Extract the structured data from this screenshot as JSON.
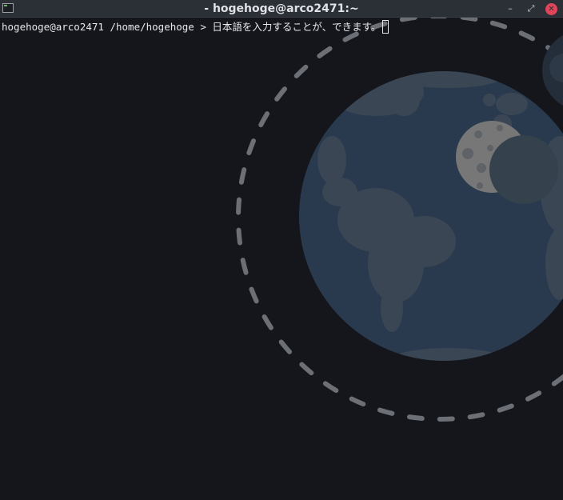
{
  "window": {
    "title": "- hogehoge@arco2471:~",
    "minimize_glyph": "–",
    "maximize_glyph": "⤢",
    "close_glyph": "✕"
  },
  "terminal": {
    "user_host": "hogehoge@arco2471",
    "cwd": "/home/hogehoge",
    "prompt_symbol": ">",
    "input_text": "日本語を入力することが、できます。"
  },
  "icons": {
    "app": "terminal-icon",
    "minimize": "minimize-icon",
    "maximize": "maximize-icon",
    "close": "close-icon"
  },
  "colors": {
    "background": "#14161b",
    "titlebar": "#2b2f36",
    "close_button": "#e0455a",
    "planet": "#2a3a4e",
    "land": "#3a4654",
    "moon": "#777777",
    "orbit": "#6c6f75"
  }
}
